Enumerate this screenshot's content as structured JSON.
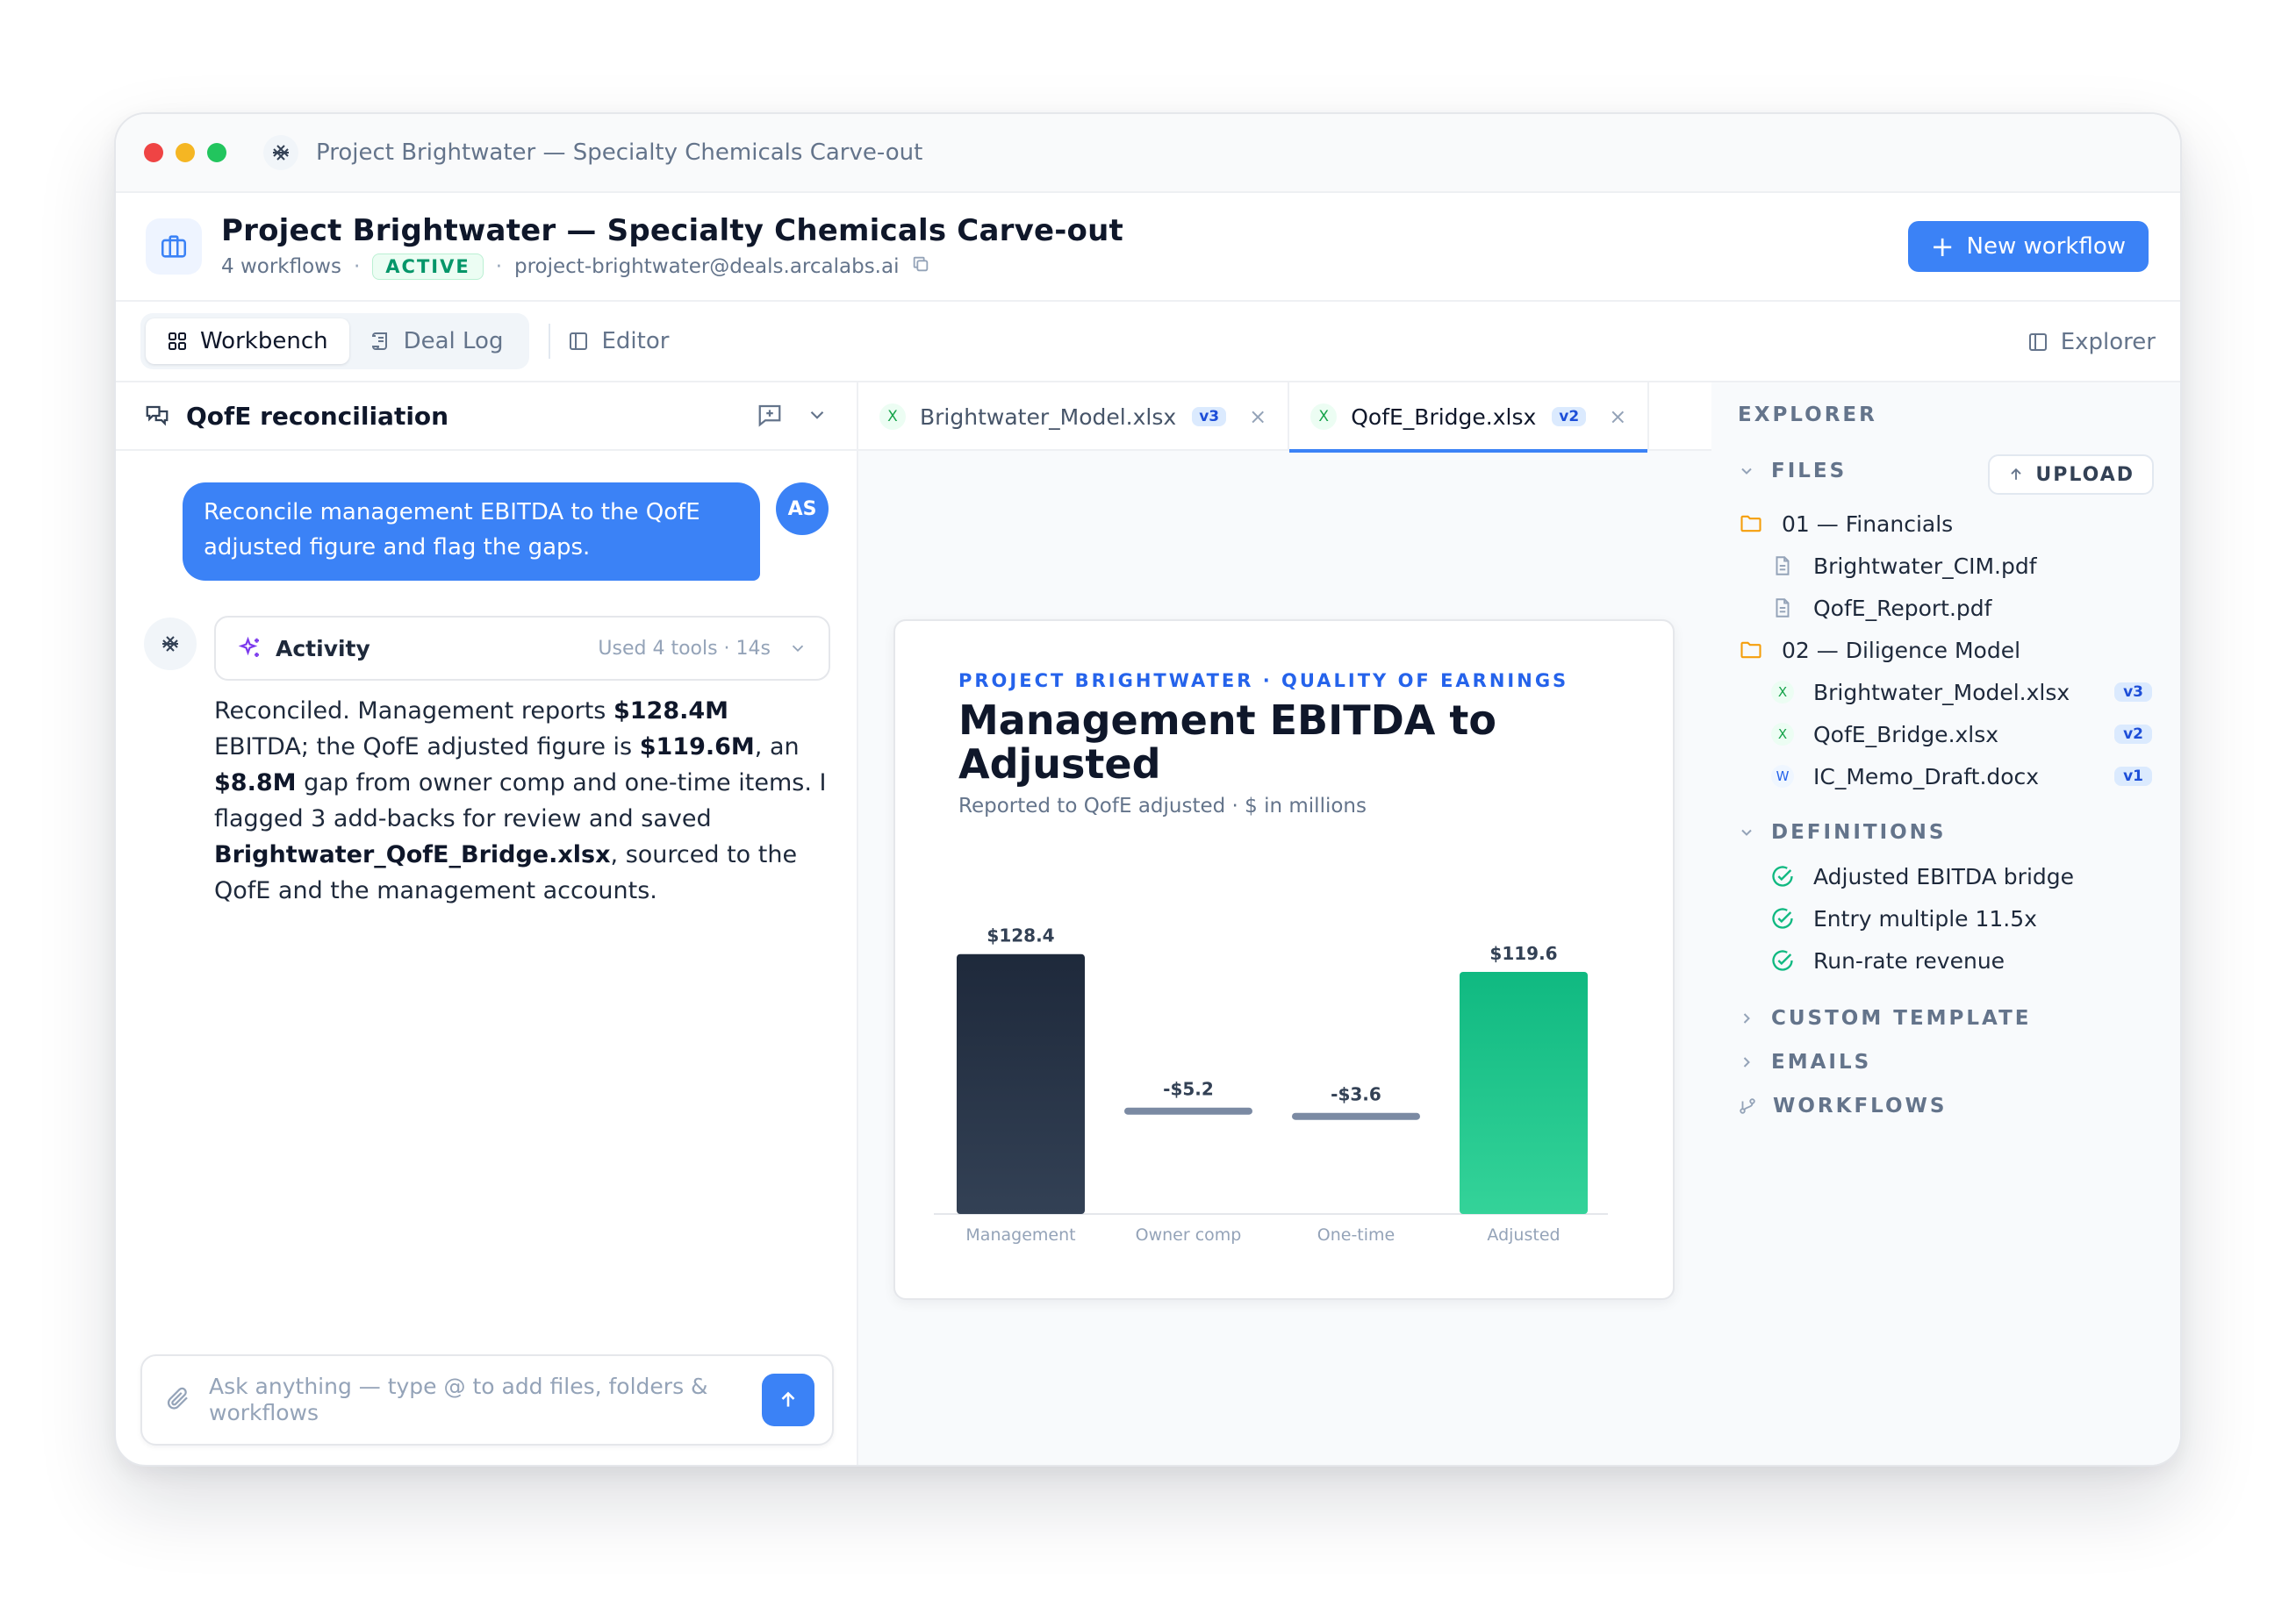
{
  "window": {
    "title": "Project Brightwater — Specialty Chemicals Carve-out"
  },
  "header": {
    "title": "Project Brightwater — Specialty Chemicals Carve-out",
    "workflows": "4 workflows",
    "status": "ACTIVE",
    "email": "project-brightwater@deals.arcalabs.ai",
    "new_workflow": "New workflow"
  },
  "toolbar": {
    "workbench": "Workbench",
    "deal_log": "Deal Log",
    "editor": "Editor",
    "explorer": "Explorer"
  },
  "chat": {
    "title": "QofE reconciliation",
    "user_message": "Reconcile management EBITDA to the QofE adjusted figure and flag the gaps.",
    "user_initials": "AS",
    "activity_label": "Activity",
    "activity_meta": "Used 4 tools · 14s",
    "response": {
      "p1": "Reconciled. Management reports ",
      "b1": "$128.4M",
      "p2": " EBITDA; the QofE adjusted figure is ",
      "b2": "$119.6M",
      "p3": ", an ",
      "b3": "$8.8M",
      "p4": " gap from owner comp and one-time items. I flagged 3 add-backs for review and saved ",
      "b4": "Brightwater_QofE_Bridge.xlsx",
      "p5": ", sourced to the QofE and the management accounts."
    },
    "composer_placeholder": "Ask anything — type @ to add files, folders & workflows"
  },
  "editor": {
    "tabs": [
      {
        "icon": "X",
        "name": "Brightwater_Model.xlsx",
        "version": "v3",
        "close": "×"
      },
      {
        "icon": "X",
        "name": "QofE_Bridge.xlsx",
        "version": "v2",
        "close": "×"
      }
    ],
    "card": {
      "kicker": "PROJECT BRIGHTWATER · QUALITY OF EARNINGS",
      "title": "Management EBITDA to Adjusted",
      "subtitle": "Reported to QofE adjusted · $ in millions"
    }
  },
  "chart_data": {
    "type": "bar",
    "subtype": "waterfall",
    "categories": [
      "Management",
      "Owner comp",
      "One-time",
      "Adjusted"
    ],
    "values": [
      128.4,
      -5.2,
      -3.6,
      119.6
    ],
    "labels": [
      "$128.4",
      "-$5.2",
      "-$3.6",
      "$119.6"
    ],
    "colors": [
      "#1e293b",
      "#7b8aa3",
      "#7b8aa3",
      "#10b981"
    ],
    "title": "Management EBITDA to Adjusted",
    "subtitle": "Reported to QofE adjusted · $ in millions",
    "xlabel": "",
    "ylabel": "",
    "ylim": [
      0,
      130
    ],
    "grid": false
  },
  "explorer": {
    "title": "EXPLORER",
    "files_label": "FILES",
    "upload": "UPLOAD",
    "folders": [
      {
        "name": "01 — Financials",
        "files": [
          {
            "type": "pdf",
            "badge": "",
            "name": "Brightwater_CIM.pdf",
            "version": ""
          },
          {
            "type": "pdf",
            "badge": "",
            "name": "QofE_Report.pdf",
            "version": ""
          }
        ]
      },
      {
        "name": "02 — Diligence Model",
        "files": [
          {
            "type": "xlsx",
            "badge": "X",
            "name": "Brightwater_Model.xlsx",
            "version": "v3"
          },
          {
            "type": "xlsx",
            "badge": "X",
            "name": "QofE_Bridge.xlsx",
            "version": "v2"
          },
          {
            "type": "docx",
            "badge": "W",
            "name": "IC_Memo_Draft.docx",
            "version": "v1"
          }
        ]
      }
    ],
    "definitions_label": "DEFINITIONS",
    "definitions": [
      "Adjusted EBITDA bridge",
      "Entry multiple 11.5x",
      "Run-rate revenue"
    ],
    "custom_template": "CUSTOM TEMPLATE",
    "emails": "EMAILS",
    "workflows": "WORKFLOWS"
  }
}
